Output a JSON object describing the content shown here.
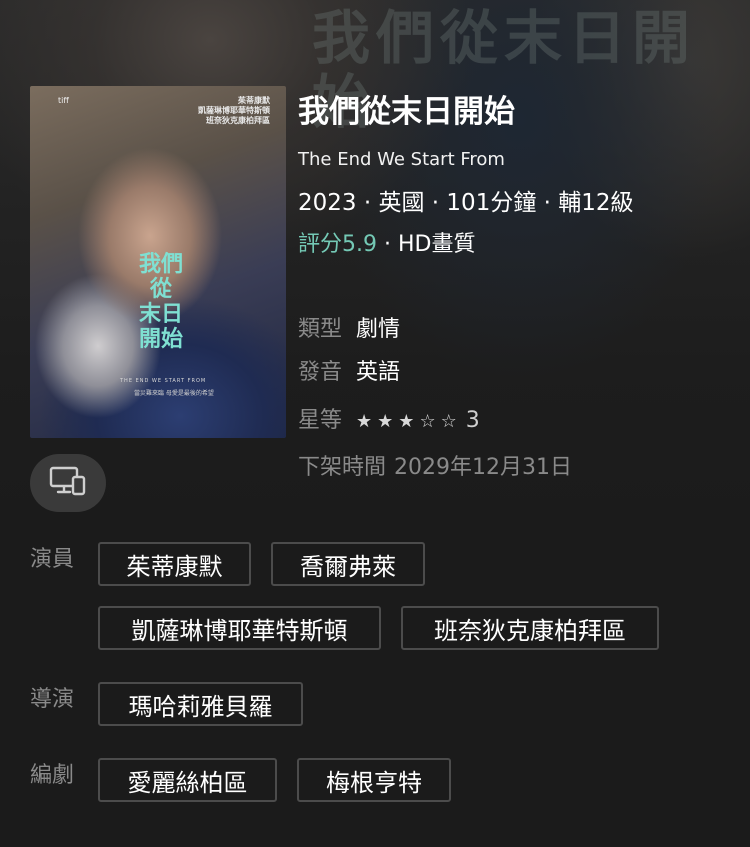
{
  "backdrop": {
    "title_text": "我們從末日開始"
  },
  "poster": {
    "logos_text": "tiff",
    "credits_lines": [
      "茱蒂康默",
      "凱薩琳博耶華特斯頓",
      "班奈狄克康柏拜區"
    ],
    "title_lines": [
      "我們",
      "從",
      "末日",
      "開始"
    ],
    "subtitle": "THE END WE START FROM",
    "tagline": "當災難來臨 母愛是最後的希望"
  },
  "movie": {
    "title": "我們從末日開始",
    "original_title": "The End We Start From",
    "year": "2023",
    "country": "英國",
    "runtime": "101分鐘",
    "rating_class": "輔12級",
    "separator": "·",
    "score": "評分5.9",
    "quality": "HD畫質"
  },
  "details": {
    "genre_label": "類型",
    "genre_value": "劇情",
    "audio_label": "發音",
    "audio_value": "英語",
    "stars_label": "星等",
    "stars_value": 3,
    "stars_max": 5,
    "stars_text": "3",
    "expire_label": "下架時間",
    "expire_value": "2029年12月31日"
  },
  "device_button": {
    "icon": "devices-icon"
  },
  "credits": {
    "cast_label": "演員",
    "cast": [
      "茱蒂康默",
      "喬爾弗萊",
      "凱薩琳博耶華特斯頓",
      "班奈狄克康柏拜區"
    ],
    "director_label": "導演",
    "directors": [
      "瑪哈莉雅貝羅"
    ],
    "writer_label": "編劇",
    "writers": [
      "愛麗絲柏區",
      "梅根亨特"
    ]
  },
  "colors": {
    "background": "#1b1b1b",
    "score": "#74c9b5",
    "muted": "#8a8a8a",
    "chip_border": "#4c4c4c"
  }
}
